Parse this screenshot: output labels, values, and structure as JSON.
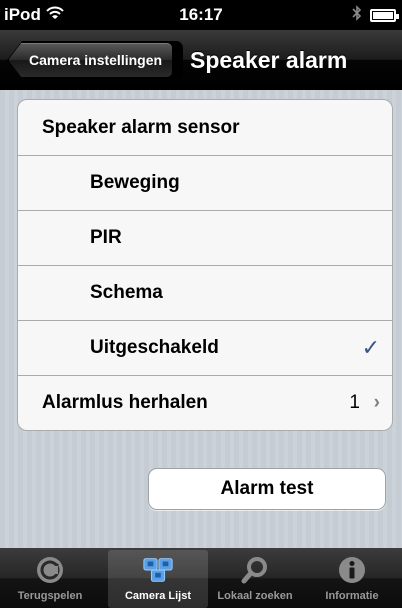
{
  "status_bar": {
    "carrier": "iPod",
    "time": "16:17"
  },
  "nav": {
    "back_label": "Camera instellingen",
    "title": "Speaker alarm"
  },
  "settings": {
    "header": "Speaker alarm sensor",
    "options": [
      {
        "label": "Beweging",
        "checked": false
      },
      {
        "label": "PIR",
        "checked": false
      },
      {
        "label": "Schema",
        "checked": false
      },
      {
        "label": "Uitgeschakeld",
        "checked": true
      }
    ],
    "check_mark": "✓",
    "repeat": {
      "label": "Alarmlus herhalen",
      "value": "1",
      "chevron": "›"
    }
  },
  "alarm_test_label": "Alarm test",
  "tabs": [
    {
      "label": "Terugspelen",
      "icon": "replay-icon",
      "selected": false
    },
    {
      "label": "Camera Lijst",
      "icon": "camera-list-icon",
      "selected": true
    },
    {
      "label": "Lokaal zoeken",
      "icon": "search-icon",
      "selected": false
    },
    {
      "label": "Informatie",
      "icon": "info-icon",
      "selected": false
    }
  ],
  "colors": {
    "checkmark": "#385487",
    "selected_tab_icon": "#5aa0e6",
    "inactive_tab_icon": "#8a8a8a"
  }
}
